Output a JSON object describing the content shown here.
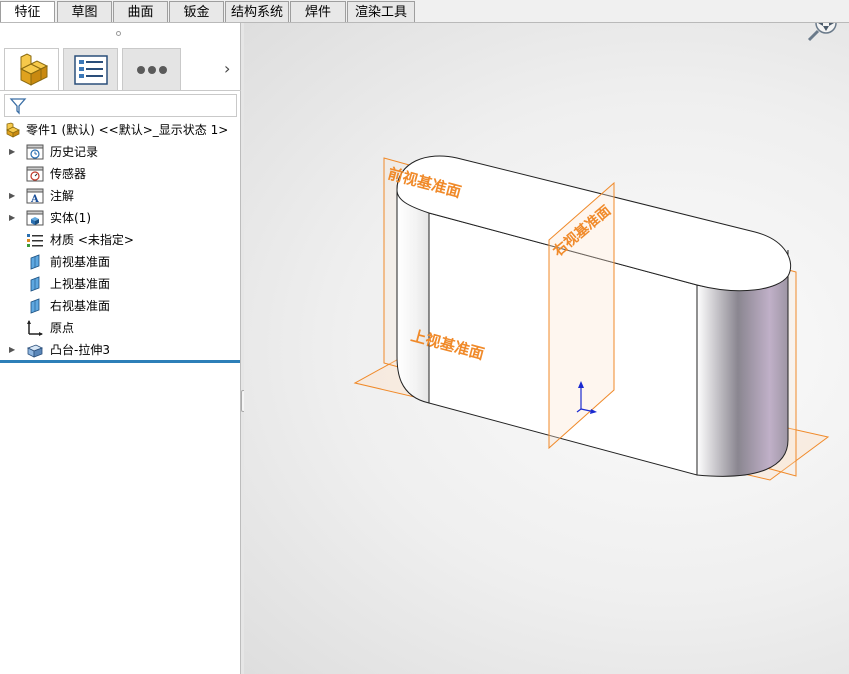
{
  "tabs": [
    {
      "label": "特征",
      "active": true
    },
    {
      "label": "草图",
      "active": false
    },
    {
      "label": "曲面",
      "active": false
    },
    {
      "label": "钣金",
      "active": false
    },
    {
      "label": "结构系统",
      "active": false
    },
    {
      "label": "焊件",
      "active": false
    },
    {
      "label": "渲染工具",
      "active": false
    }
  ],
  "panel": {
    "tabs": [
      "featuremanager-icon",
      "propertymanager-icon",
      "more-icon"
    ],
    "expand_icon": "chevron-right-icon",
    "filter_icon": "funnel-icon"
  },
  "tree": {
    "root": "零件1 (默认) <<默认>_显示状态 1>",
    "items": [
      {
        "label": "历史记录",
        "icon": "history-icon",
        "expandable": true
      },
      {
        "label": "传感器",
        "icon": "sensor-icon",
        "expandable": false
      },
      {
        "label": "注解",
        "icon": "annotation-icon",
        "expandable": true
      },
      {
        "label": "实体(1)",
        "icon": "solid-body-icon",
        "expandable": true
      },
      {
        "label": "材质 <未指定>",
        "icon": "material-icon",
        "expandable": false
      },
      {
        "label": "前视基准面",
        "icon": "plane-icon",
        "expandable": false
      },
      {
        "label": "上视基准面",
        "icon": "plane-icon",
        "expandable": false
      },
      {
        "label": "右视基准面",
        "icon": "plane-icon",
        "expandable": false
      },
      {
        "label": "原点",
        "icon": "origin-icon",
        "expandable": false
      },
      {
        "label": "凸台-拉伸3",
        "icon": "extrude-icon",
        "expandable": true
      }
    ]
  },
  "viewport": {
    "planes": {
      "front": "前视基准面",
      "top": "上视基准面",
      "right": "右视基准面"
    },
    "view_control_icon": "zoom-view-icon",
    "plane_color": "#f08a2a",
    "axis_color": "#1a2ad0"
  }
}
